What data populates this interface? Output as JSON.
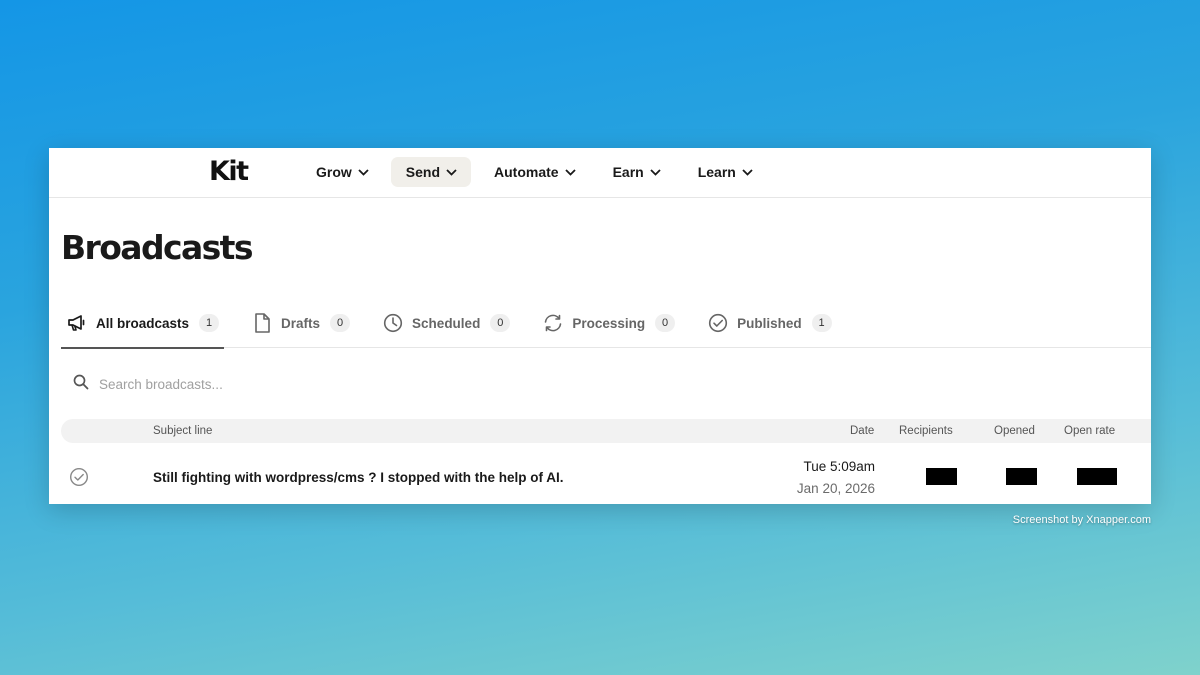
{
  "nav": {
    "logo": "Kit",
    "items": [
      {
        "label": "Grow",
        "active": false
      },
      {
        "label": "Send",
        "active": true
      },
      {
        "label": "Automate",
        "active": false
      },
      {
        "label": "Earn",
        "active": false
      },
      {
        "label": "Learn",
        "active": false
      }
    ]
  },
  "page": {
    "title": "Broadcasts"
  },
  "tabs": [
    {
      "label": "All broadcasts",
      "count": "1",
      "icon": "megaphone-icon"
    },
    {
      "label": "Drafts",
      "count": "0",
      "icon": "document-icon"
    },
    {
      "label": "Scheduled",
      "count": "0",
      "icon": "clock-icon"
    },
    {
      "label": "Processing",
      "count": "0",
      "icon": "refresh-icon"
    },
    {
      "label": "Published",
      "count": "1",
      "icon": "check-circle-icon"
    }
  ],
  "search": {
    "placeholder": "Search broadcasts..."
  },
  "table": {
    "columns": {
      "subject": "Subject line",
      "date": "Date",
      "recipients": "Recipients",
      "opened": "Opened",
      "open_rate": "Open rate"
    },
    "rows": [
      {
        "subject": "Still fighting with wordpress/cms ? I stopped with the help of AI.",
        "time": "Tue 5:09am",
        "date": "Jan 20, 2026"
      }
    ]
  },
  "watermark": "Screenshot by Xnapper.com",
  "colors": {
    "accent_bg": "#f1efea",
    "text": "#1a1a1a",
    "muted": "#666666"
  }
}
